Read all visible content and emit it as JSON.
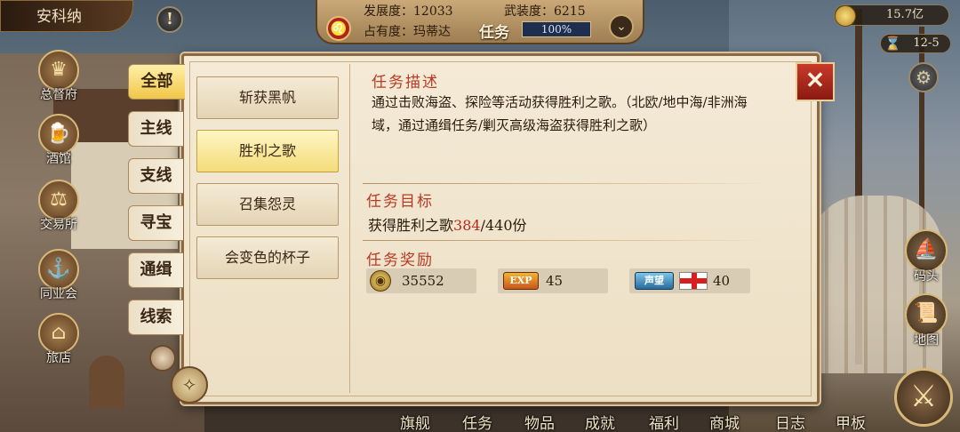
{
  "hud": {
    "city_name": "安科纳",
    "alert_symbol": "!",
    "development": "发展度：12033",
    "armament": "武装度：6215",
    "occupancy": "占有度：玛蒂达",
    "task_label": "任务",
    "task_progress": "100%",
    "gold": "15.7亿",
    "date": "12-5"
  },
  "left_nav": [
    {
      "label": "总督府",
      "icon": "crown-icon"
    },
    {
      "label": "酒馆",
      "icon": "tavern-icon"
    },
    {
      "label": "交易所",
      "icon": "scales-icon"
    },
    {
      "label": "同业会",
      "icon": "anchor-icon"
    },
    {
      "label": "旅店",
      "icon": "inn-icon"
    }
  ],
  "right_nav": [
    {
      "label": "码头",
      "icon": "dock-icon"
    },
    {
      "label": "地图",
      "icon": "map-scroll-icon"
    }
  ],
  "bottom_menu": [
    "旗舰",
    "任务",
    "物品",
    "成就",
    "福利",
    "商城",
    "日志",
    "甲板"
  ],
  "category_tabs": [
    "全部",
    "主线",
    "支线",
    "寻宝",
    "通缉",
    "线索"
  ],
  "active_category": 0,
  "tasks": [
    "斩获黑帆",
    "胜利之歌",
    "召集怨灵",
    "会变色的杯子"
  ],
  "active_task": 1,
  "detail": {
    "desc_title": "任务描述",
    "desc_text": "通过击败海盗、探险等活动获得胜利之歌。（北欧/地中海/非洲海域，通过通缉任务/剿灭高级海盗获得胜利之歌）",
    "goal_title": "任务目标",
    "goal_prefix": "获得胜利之歌",
    "goal_current": "384",
    "goal_suffix": "/440份",
    "reward_title": "任务奖励",
    "rewards": {
      "gold": "35552",
      "exp_badge": "EXP",
      "exp": "45",
      "fame_badge": "声望",
      "fame": "40"
    }
  },
  "close_symbol": "✕"
}
